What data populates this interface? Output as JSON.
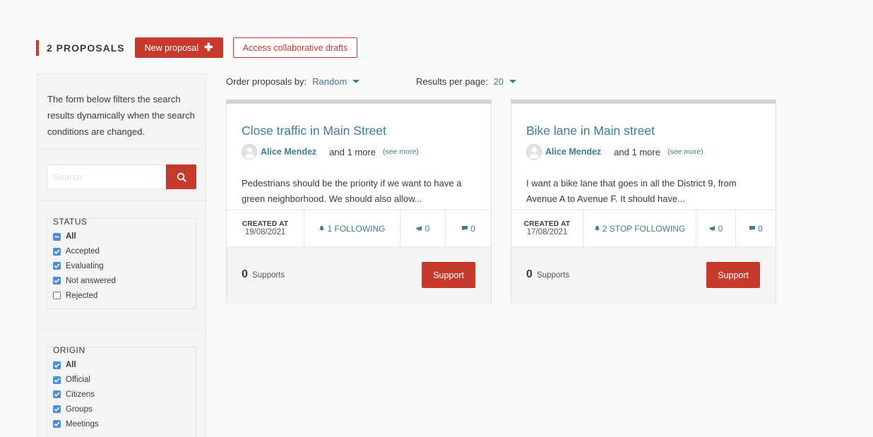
{
  "header": {
    "title": "2 PROPOSALS",
    "new_proposal_label": "New proposal",
    "drafts_label": "Access collaborative drafts"
  },
  "sidebar": {
    "intro": "The form below filters the search results dynamically when the search conditions are changed.",
    "search_placeholder": "Search",
    "status": {
      "legend": "STATUS",
      "options": [
        {
          "label": "All",
          "state": "mixed"
        },
        {
          "label": "Accepted",
          "state": "checked"
        },
        {
          "label": "Evaluating",
          "state": "checked"
        },
        {
          "label": "Not answered",
          "state": "checked"
        },
        {
          "label": "Rejected",
          "state": "unchecked"
        }
      ]
    },
    "origin": {
      "legend": "ORIGIN",
      "options": [
        {
          "label": "All",
          "state": "checked"
        },
        {
          "label": "Official",
          "state": "checked"
        },
        {
          "label": "Citizens",
          "state": "checked"
        },
        {
          "label": "Groups",
          "state": "checked"
        },
        {
          "label": "Meetings",
          "state": "checked"
        }
      ]
    }
  },
  "toolbar": {
    "order_label": "Order proposals by:",
    "order_value": "Random",
    "perpage_label": "Results per page:",
    "perpage_value": "20"
  },
  "cards": [
    {
      "title": "Close traffic in Main Street",
      "author": "Alice Mendez",
      "and_more": "and 1 more",
      "see_more": "(see more)",
      "body": "Pedestrians should be the priority if we want to have a green neighborhood. We should also allow...",
      "created_label": "CREATED AT",
      "created_date": "19/08/2021",
      "follow_label": "1 FOLLOWING",
      "endorsements": "0",
      "comments": "0",
      "supports_count": "0",
      "supports_label": "Supports",
      "support_button": "Support"
    },
    {
      "title": "Bike lane in Main street",
      "author": "Alice Mendez",
      "and_more": "and 1 more",
      "see_more": "(see more)",
      "body": "I want a bike lane that goes in all the District 9, from Avenue A to Avenue F. It should have...",
      "created_label": "CREATED AT",
      "created_date": "17/08/2021",
      "follow_label": "2 STOP FOLLOWING",
      "endorsements": "0",
      "comments": "0",
      "supports_count": "0",
      "supports_label": "Supports",
      "support_button": "Support"
    }
  ],
  "colors": {
    "primary": "#c53a2a",
    "link": "#3c7e8c",
    "checkbox": "#4a90d9"
  }
}
